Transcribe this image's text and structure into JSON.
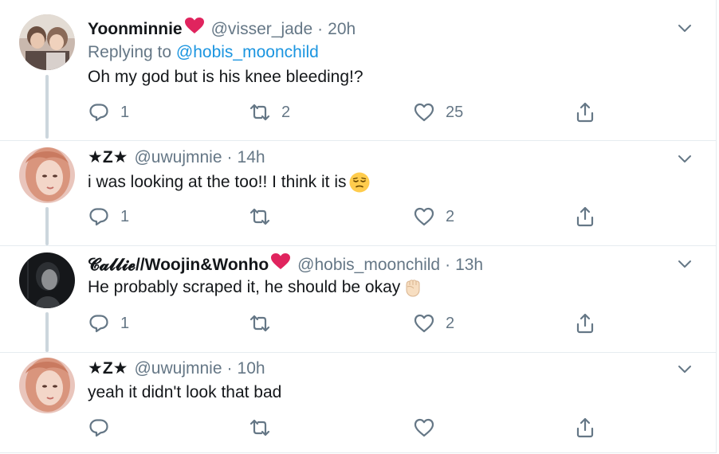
{
  "tweets": [
    {
      "name": "Yoonminnie",
      "handle": "@visser_jade",
      "time": "20h",
      "replying_prefix": "Replying to",
      "replying_to": "@hobis_moonchild",
      "text": "Oh my god but is his knee bleeding!?",
      "replies": "1",
      "retweets": "2",
      "likes": "25"
    },
    {
      "name": "★Z★",
      "handle": "@uwujmnie",
      "time": "14h",
      "text": "i was looking at the too!! I think it is",
      "replies": "1",
      "retweets": "",
      "likes": "2"
    },
    {
      "name": "𝓒𝓪𝓵𝓵𝓲𝓮//Woojin&Wonho",
      "handle": "@hobis_moonchild",
      "time": "13h",
      "text": "He probably scraped it, he should be okay",
      "replies": "1",
      "retweets": "",
      "likes": "2"
    },
    {
      "name": "★Z★",
      "handle": "@uwujmnie",
      "time": "10h",
      "text": "yeah it didn't look that bad",
      "replies": "",
      "retweets": "",
      "likes": ""
    }
  ],
  "icons": {
    "reply": "reply-icon",
    "retweet": "retweet-icon",
    "like": "like-icon",
    "share": "share-icon",
    "more": "chevron-down-icon"
  },
  "colors": {
    "text": "#14171a",
    "secondary": "#657786",
    "link": "#1b95e0",
    "heart": "#e0245e",
    "thread_line": "#ccd6dd",
    "divider": "#e6ecf0"
  }
}
